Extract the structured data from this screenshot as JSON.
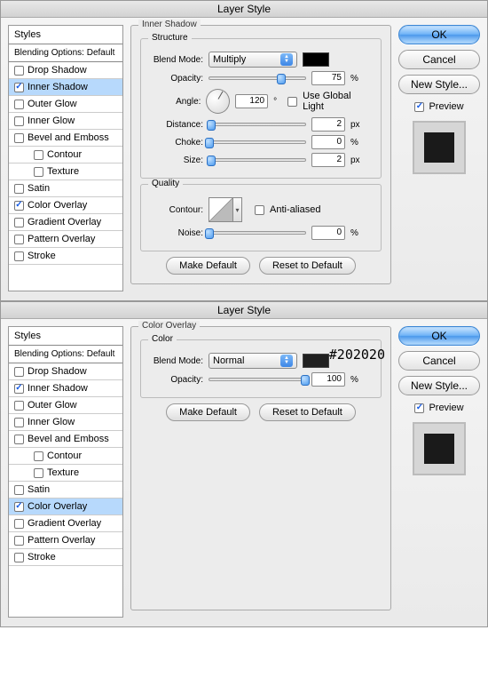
{
  "dialogs": [
    {
      "title": "Layer Style",
      "sidebar": {
        "head": "Styles",
        "blending": "Blending Options: Default",
        "items": [
          {
            "label": "Drop Shadow",
            "checked": false,
            "selected": false,
            "indent": false
          },
          {
            "label": "Inner Shadow",
            "checked": true,
            "selected": true,
            "indent": false
          },
          {
            "label": "Outer Glow",
            "checked": false,
            "selected": false,
            "indent": false
          },
          {
            "label": "Inner Glow",
            "checked": false,
            "selected": false,
            "indent": false
          },
          {
            "label": "Bevel and Emboss",
            "checked": false,
            "selected": false,
            "indent": false
          },
          {
            "label": "Contour",
            "checked": false,
            "selected": false,
            "indent": true
          },
          {
            "label": "Texture",
            "checked": false,
            "selected": false,
            "indent": true
          },
          {
            "label": "Satin",
            "checked": false,
            "selected": false,
            "indent": false
          },
          {
            "label": "Color Overlay",
            "checked": true,
            "selected": false,
            "indent": false
          },
          {
            "label": "Gradient Overlay",
            "checked": false,
            "selected": false,
            "indent": false
          },
          {
            "label": "Pattern Overlay",
            "checked": false,
            "selected": false,
            "indent": false
          },
          {
            "label": "Stroke",
            "checked": false,
            "selected": false,
            "indent": false
          }
        ]
      },
      "panel": {
        "name": "Inner Shadow",
        "groups": [
          {
            "name": "Structure",
            "rows": [
              {
                "type": "select",
                "label": "Blend Mode:",
                "value": "Multiply",
                "swatch": "#000000"
              },
              {
                "type": "slider",
                "label": "Opacity:",
                "value": "75",
                "unit": "%",
                "thumb": 75
              },
              {
                "type": "angle",
                "label": "Angle:",
                "value": "120",
                "unit": "°",
                "check_label": "Use Global Light",
                "checked": false
              },
              {
                "type": "slider",
                "label": "Distance:",
                "value": "2",
                "unit": "px",
                "thumb": 2
              },
              {
                "type": "slider",
                "label": "Choke:",
                "value": "0",
                "unit": "%",
                "thumb": 0
              },
              {
                "type": "slider",
                "label": "Size:",
                "value": "2",
                "unit": "px",
                "thumb": 2
              }
            ]
          },
          {
            "name": "Quality",
            "rows": [
              {
                "type": "contour",
                "label": "Contour:",
                "check_label": "Anti-aliased",
                "checked": false
              },
              {
                "type": "slider",
                "label": "Noise:",
                "value": "0",
                "unit": "%",
                "thumb": 0
              }
            ]
          }
        ],
        "buttons": [
          "Make Default",
          "Reset to Default"
        ]
      },
      "right": {
        "ok": "OK",
        "cancel": "Cancel",
        "new_style": "New Style...",
        "preview": "Preview",
        "preview_checked": true
      }
    },
    {
      "title": "Layer Style",
      "sidebar": {
        "head": "Styles",
        "blending": "Blending Options: Default",
        "items": [
          {
            "label": "Drop Shadow",
            "checked": false,
            "selected": false,
            "indent": false
          },
          {
            "label": "Inner Shadow",
            "checked": true,
            "selected": false,
            "indent": false
          },
          {
            "label": "Outer Glow",
            "checked": false,
            "selected": false,
            "indent": false
          },
          {
            "label": "Inner Glow",
            "checked": false,
            "selected": false,
            "indent": false
          },
          {
            "label": "Bevel and Emboss",
            "checked": false,
            "selected": false,
            "indent": false
          },
          {
            "label": "Contour",
            "checked": false,
            "selected": false,
            "indent": true
          },
          {
            "label": "Texture",
            "checked": false,
            "selected": false,
            "indent": true
          },
          {
            "label": "Satin",
            "checked": false,
            "selected": false,
            "indent": false
          },
          {
            "label": "Color Overlay",
            "checked": true,
            "selected": true,
            "indent": false
          },
          {
            "label": "Gradient Overlay",
            "checked": false,
            "selected": false,
            "indent": false
          },
          {
            "label": "Pattern Overlay",
            "checked": false,
            "selected": false,
            "indent": false
          },
          {
            "label": "Stroke",
            "checked": false,
            "selected": false,
            "indent": false
          }
        ]
      },
      "panel": {
        "name": "Color Overlay",
        "annotation": "#202020",
        "groups": [
          {
            "name": "Color",
            "rows": [
              {
                "type": "select",
                "label": "Blend Mode:",
                "value": "Normal",
                "swatch": "#202020"
              },
              {
                "type": "slider",
                "label": "Opacity:",
                "value": "100",
                "unit": "%",
                "thumb": 100
              }
            ]
          }
        ],
        "buttons": [
          "Make Default",
          "Reset to Default"
        ]
      },
      "right": {
        "ok": "OK",
        "cancel": "Cancel",
        "new_style": "New Style...",
        "preview": "Preview",
        "preview_checked": true
      }
    }
  ]
}
